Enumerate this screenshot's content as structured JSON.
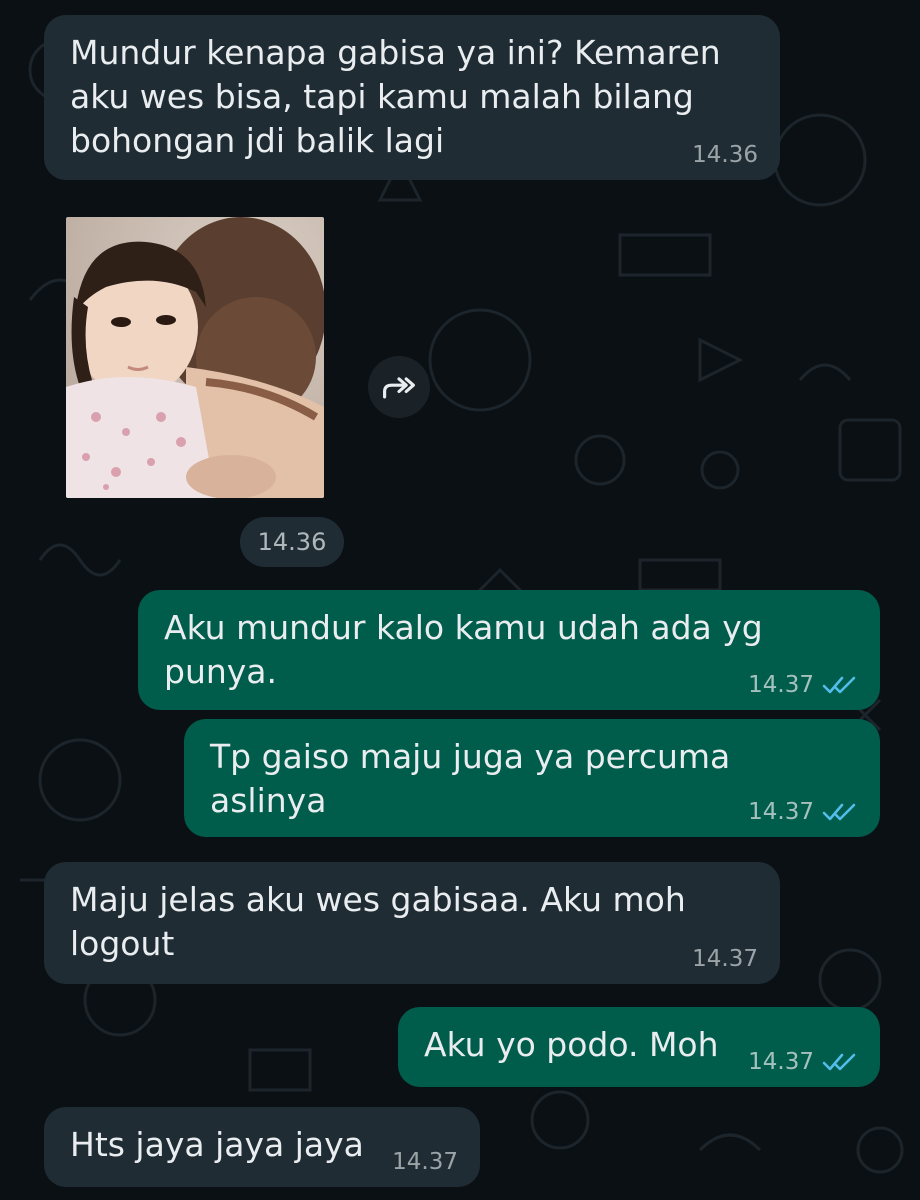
{
  "messages": [
    {
      "direction": "incoming",
      "text": "Mundur kenapa gabisa ya ini? Kemaren\naku wes bisa, tapi kamu malah bilang\nbohongan jdi balik lagi",
      "time": "14.36"
    },
    {
      "direction": "incoming",
      "type": "photo",
      "time": "14.36",
      "forward_icon": "forward-icon"
    },
    {
      "direction": "outgoing",
      "text": "Aku mundur kalo kamu udah ada yg\npunya.",
      "time": "14.37",
      "status": "read",
      "status_icon": "double-check-icon"
    },
    {
      "direction": "outgoing",
      "text": "Tp gaiso maju juga ya percuma aslinya",
      "time": "14.37",
      "status": "read",
      "status_icon": "double-check-icon"
    },
    {
      "direction": "incoming",
      "text": "Maju jelas aku wes gabisaa. Aku moh\nlogout",
      "time": "14.37"
    },
    {
      "direction": "outgoing",
      "text": "Aku yo podo. Moh",
      "time": "14.37",
      "status": "read",
      "status_icon": "double-check-icon"
    },
    {
      "direction": "incoming",
      "text": "Hts jaya jaya jaya",
      "time": "14.37"
    }
  ],
  "colors": {
    "background": "#0b1014",
    "incoming_bubble": "#1f2c34",
    "outgoing_bubble": "#005c4b",
    "read_ticks": "#53bdeb",
    "text": "#e9edef"
  }
}
